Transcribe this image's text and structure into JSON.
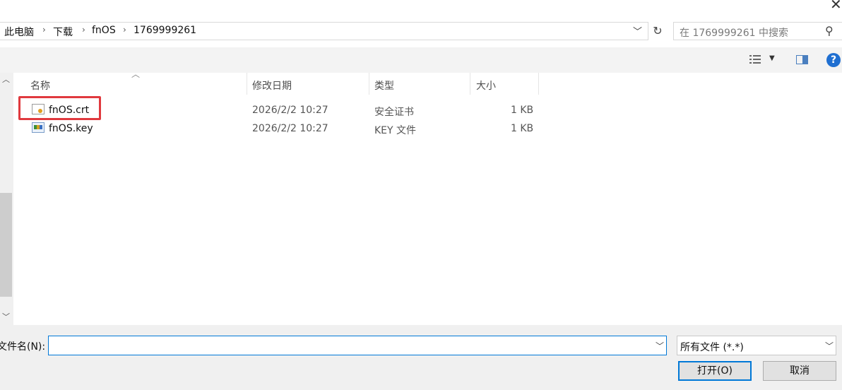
{
  "breadcrumb": {
    "items": [
      "此电脑",
      "下载",
      "fnOS",
      "1769999261"
    ],
    "separator": "›"
  },
  "search": {
    "placeholder": "在 1769999261 中搜索"
  },
  "columns": {
    "name": "名称",
    "modified": "修改日期",
    "type": "类型",
    "size": "大小"
  },
  "files": [
    {
      "name": "fnOS.crt",
      "modified": "2026/2/2 10:27",
      "type": "安全证书",
      "size": "1 KB",
      "icon": "certificate-icon",
      "highlighted": true
    },
    {
      "name": "fnOS.key",
      "modified": "2026/2/2 10:27",
      "type": "KEY 文件",
      "size": "1 KB",
      "icon": "key-file-icon",
      "highlighted": false
    }
  ],
  "filename": {
    "label": "文件名(N):",
    "value": ""
  },
  "filetype": {
    "selected": "所有文件 (*.*)"
  },
  "buttons": {
    "open": "打开(O)",
    "cancel": "取消"
  },
  "colors": {
    "accent": "#0078d7",
    "highlight": "#e0393e",
    "help": "#1f6fd1"
  }
}
